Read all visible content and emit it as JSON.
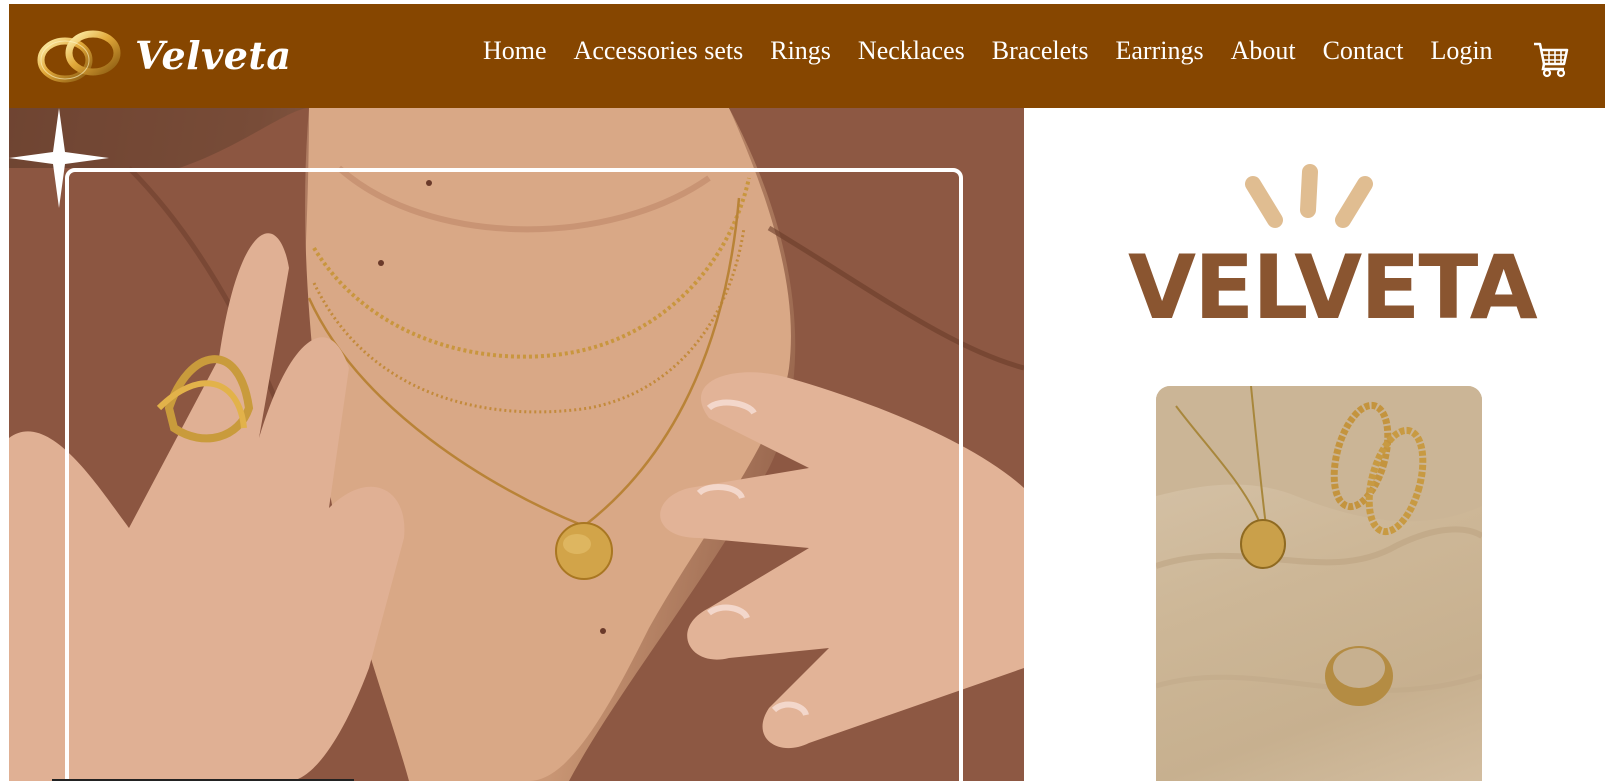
{
  "header": {
    "brand": "Velveta",
    "background_color": "#864600",
    "logo_icon": "wedding-rings-icon",
    "cart_icon": "shopping-cart-icon"
  },
  "nav": {
    "items": [
      {
        "label": "Home"
      },
      {
        "label": "Accessories sets"
      },
      {
        "label": "Rings"
      },
      {
        "label": "Necklaces"
      },
      {
        "label": "Bracelets"
      },
      {
        "label": "Earrings"
      },
      {
        "label": "About"
      },
      {
        "label": "Contact"
      },
      {
        "label": "Login"
      }
    ]
  },
  "side": {
    "brand_wordmark": "VELVETA",
    "wordmark_color": "#8a5530",
    "ray_color": "#e0bd91"
  },
  "hero": {
    "image": "model-wearing-gold-necklaces-and-snake-ring",
    "sparkle_icon": "sparkle-star-icon"
  },
  "product": {
    "image": "gold-pendant-hoop-earrings-and-ring-on-fabric"
  }
}
